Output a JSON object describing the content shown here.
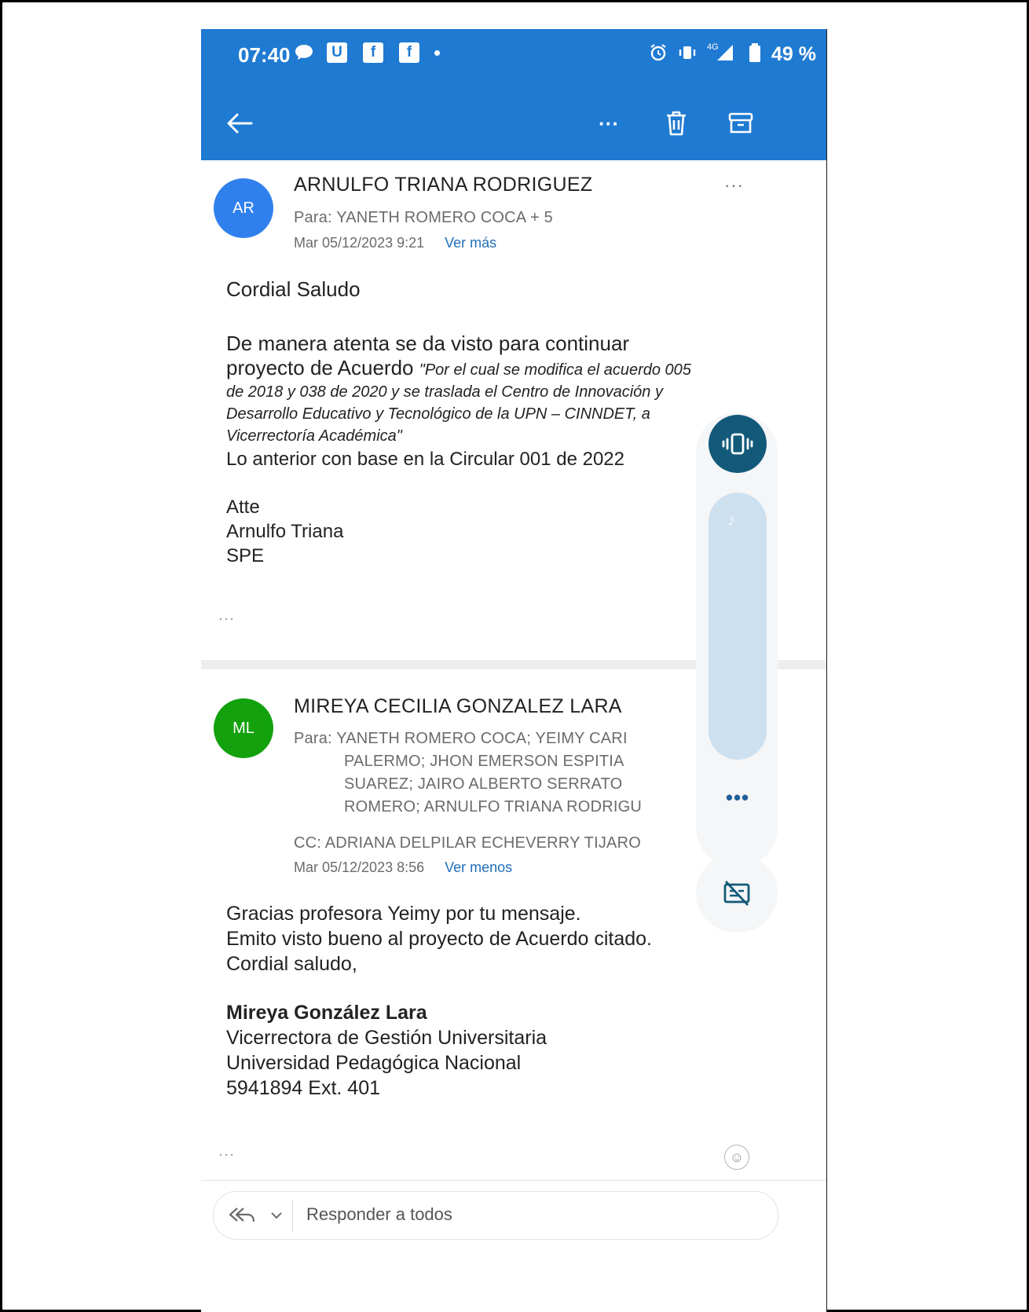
{
  "status_bar": {
    "time": "07:40",
    "fb_glyph": "f",
    "u_glyph": "U",
    "network": "4G",
    "battery": "49 %"
  },
  "toolbar": {
    "more_label": "···"
  },
  "message1": {
    "avatar_initials": "AR",
    "avatar_color": "#2f80ed",
    "sender": "ARNULFO TRIANA RODRIGUEZ",
    "to": "Para: YANETH ROMERO COCA  + 5",
    "date": "Mar 05/12/2023 9:21",
    "toggle_link": "Ver más",
    "more_label": "···",
    "greeting": "Cordial Saludo",
    "body_line1": "De manera atenta se da visto para continuar",
    "body_line2_start": "proyecto de Acuerdo ",
    "quote_line1": "\"Por el cual se modifica el acuerdo 005",
    "quote_line2": "de 2018 y 038 de 2020 y se  traslada el Centro de Innovación y",
    "quote_line3": "Desarrollo Educativo y Tecnológico de la UPN – CINNDET, a",
    "quote_line4": "Vicerrectoría Académica\"",
    "body_line3": "Lo anterior con base en la Circular 001 de 2022",
    "sign1": "Atte",
    "sign2": "Arnulfo Triana",
    "sign3": "SPE",
    "collapsed": "···"
  },
  "message2": {
    "avatar_initials": "ML",
    "avatar_color": "#13a10e",
    "sender": "MIREYA CECILIA GONZALEZ LARA",
    "to_line1": "Para: YANETH ROMERO COCA;  YEIMY CARI",
    "to_line2": "PALERMO;  JHON EMERSON ESPITIA",
    "to_line3": "SUAREZ;  JAIRO ALBERTO SERRATO",
    "to_line4": "ROMERO;  ARNULFO TRIANA RODRIGU",
    "cc": "CC: ADRIANA DELPILAR ECHEVERRY TIJARO",
    "date": "Mar 05/12/2023 8:56",
    "toggle_link": "Ver menos",
    "body_line1": "Gracias profesora Yeimy por tu mensaje.",
    "body_line2": "Emito visto bueno al proyecto de Acuerdo citado.",
    "body_line3": "Cordial saludo,",
    "sig_name": "Mireya González Lara",
    "sig_title": "Vicerrectora de Gestión Universitaria",
    "sig_org": "Universidad Pedagógica Nacional",
    "sig_phone": "5941894 Ext. 401",
    "collapsed": "···"
  },
  "volume_panel": {
    "more_label": "•••",
    "note_glyph": "♪"
  },
  "reply": {
    "placeholder": "Responder a todos",
    "emoji_glyph": "☺"
  },
  "colors": {
    "accent": "#1f7ad2",
    "link": "#1f6fb8",
    "vibrate_button": "#135a7a",
    "volume_track": "#cde0f0"
  }
}
